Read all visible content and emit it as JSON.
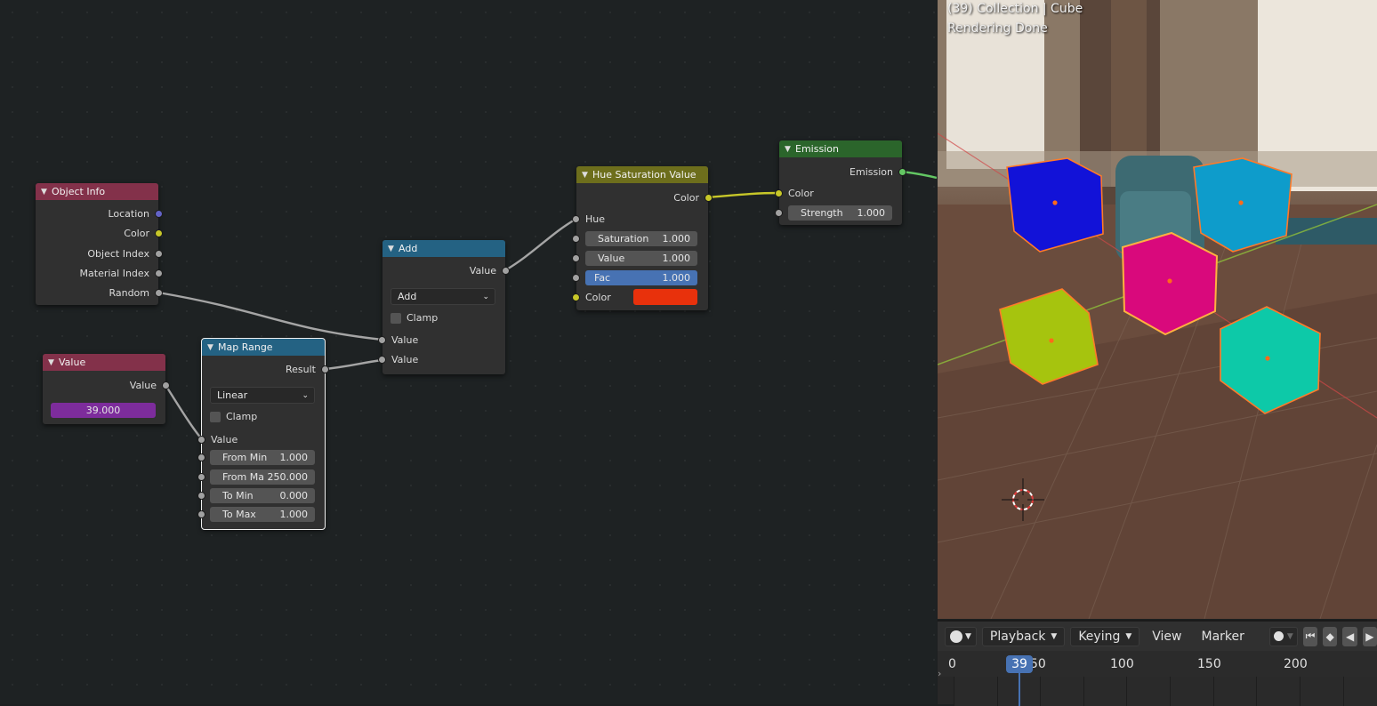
{
  "node_editor": {
    "nodes": {
      "object_info": {
        "title": "Object Info",
        "outputs": [
          "Location",
          "Color",
          "Object Index",
          "Material Index",
          "Random"
        ]
      },
      "value": {
        "title": "Value",
        "output": "Value",
        "value": "39.000"
      },
      "map_range": {
        "title": "Map Range",
        "output": "Result",
        "interpolation": "Linear",
        "clamp_label": "Clamp",
        "input_label": "Value",
        "fields": [
          {
            "label": "From Min",
            "value": "1.000"
          },
          {
            "label": "From Ma",
            "value": "250.000"
          },
          {
            "label": "To Min",
            "value": "0.000"
          },
          {
            "label": "To Max",
            "value": "1.000"
          }
        ]
      },
      "add": {
        "title": "Add",
        "output": "Value",
        "operation": "Add",
        "clamp_label": "Clamp",
        "inputs": [
          "Value",
          "Value"
        ]
      },
      "hsv": {
        "title": "Hue Saturation Value",
        "output": "Color",
        "hue_label": "Hue",
        "fields": [
          {
            "label": "Saturation",
            "value": "1.000"
          },
          {
            "label": "Value",
            "value": "1.000"
          },
          {
            "label": "Fac",
            "value": "1.000"
          }
        ],
        "color_label": "Color",
        "color_swatch": "#e8310c"
      },
      "emission": {
        "title": "Emission",
        "output": "Emission",
        "color_label": "Color",
        "strength_label": "Strength",
        "strength_value": "1.000"
      }
    }
  },
  "viewport": {
    "title_line": "(39) Collection | Cube",
    "status_line": "Rendering Done",
    "cube_colors": [
      "#1212d8",
      "#0e9ccb",
      "#d9097c",
      "#a6c40e",
      "#0dc9a8"
    ]
  },
  "timeline": {
    "menu": {
      "playback": "Playback",
      "keying": "Keying",
      "view": "View",
      "marker": "Marker"
    },
    "ruler_ticks": [
      "0",
      "50",
      "100",
      "150",
      "200"
    ],
    "current_frame": "39"
  }
}
